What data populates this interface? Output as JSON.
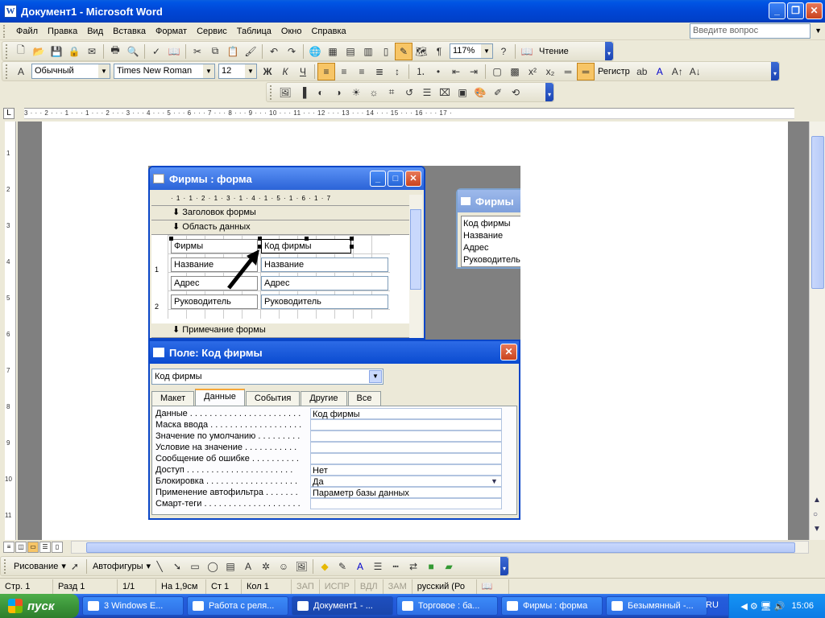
{
  "window": {
    "title": "Документ1 - Microsoft Word",
    "app_icon": "W"
  },
  "menu": {
    "items": [
      "Файл",
      "Правка",
      "Вид",
      "Вставка",
      "Формат",
      "Сервис",
      "Таблица",
      "Окно",
      "Справка"
    ],
    "help_placeholder": "Введите вопрос"
  },
  "standard_toolbar": {
    "zoom": "117%",
    "reading_label": "Чтение"
  },
  "format_toolbar": {
    "style": "Обычный",
    "font": "Times New Roman",
    "size": "12",
    "bold": "Ж",
    "italic": "К",
    "underline": "Ч",
    "register_label": "Регистр"
  },
  "ruler": {
    "h_text": "3 · · · 2 · · · 1 · · · 1 · · · 2 · · · 3 · · · 4 · · · 5 · · · 6 · · · 7 · · · 8 · · · 9 · · · 10 · · · 11 · · · 12 · · · 13 · · · 14 · · · 15 · · · 16 · · · 17 ·",
    "v_labels": [
      "1",
      "2",
      "3",
      "4",
      "5",
      "6",
      "7",
      "8",
      "9",
      "10",
      "11"
    ]
  },
  "access_form": {
    "title": "Фирмы : форма",
    "ruler_text": "· 1 · 1 · 2 · 1 · 3 · 1 · 4 · 1 · 5 · 1 · 6 · 1 · 7",
    "header_section": "Заголовок формы",
    "detail_section": "Область данных",
    "footer_section": "Примечание формы",
    "v_marks": [
      "1",
      "2"
    ],
    "rows": [
      {
        "label": "Фирмы",
        "field": "Код фирмы"
      },
      {
        "label": "Название",
        "field": "Название"
      },
      {
        "label": "Адрес",
        "field": "Адрес"
      },
      {
        "label": "Руководитель",
        "field": "Руководитель"
      }
    ]
  },
  "field_list": {
    "title": "Фирмы",
    "items": [
      "Код фирмы",
      "Название",
      "Адрес",
      "Руководитель"
    ]
  },
  "property_sheet": {
    "title": "Поле: Код фирмы",
    "selected": "Код фирмы",
    "tabs": [
      "Макет",
      "Данные",
      "События",
      "Другие",
      "Все"
    ],
    "active_tab": "Данные",
    "rows": [
      {
        "label": "Данные . . . . . . . . . . . . . . . . . . . . . . .",
        "value": "Код фирмы"
      },
      {
        "label": "Маска ввода . . . . . . . . . . . . . . . . . . .",
        "value": ""
      },
      {
        "label": "Значение по умолчанию . . . . . . . . .",
        "value": ""
      },
      {
        "label": "Условие на значение . . . . . . . . . . .",
        "value": ""
      },
      {
        "label": "Сообщение об ошибке . . . . . . . . . .",
        "value": ""
      },
      {
        "label": "Доступ . . . . . . . . . . . . . . . . . . . . . .",
        "value": "Нет"
      },
      {
        "label": "Блокировка . . . . . . . . . . . . . . . . . . .",
        "value": "Да"
      },
      {
        "label": "Применение автофильтра . . . . . . .",
        "value": "Параметр базы данных"
      },
      {
        "label": "Смарт-теги . . . . . . . . . . . . . . . . . . . .",
        "value": ""
      }
    ]
  },
  "drawing_toolbar": {
    "draw_label": "Рисование",
    "autoshapes_label": "Автофигуры"
  },
  "status": {
    "page": "Стр. 1",
    "section": "Разд 1",
    "pages": "1/1",
    "at": "На 1,9см",
    "line": "Ст 1",
    "col": "Кол 1",
    "rec": "ЗАП",
    "trk": "ИСПР",
    "ext": "ВДЛ",
    "ovr": "ЗАМ",
    "lang": "русский (Ро"
  },
  "taskbar": {
    "start": "пуск",
    "tasks": [
      "3 Windows E...",
      "Работа с реля...",
      "Документ1 - ...",
      "Торговое : ба...",
      "Фирмы : форма",
      "Безымянный -..."
    ],
    "active_task": 2,
    "lang": "RU",
    "clock": "15:06"
  }
}
